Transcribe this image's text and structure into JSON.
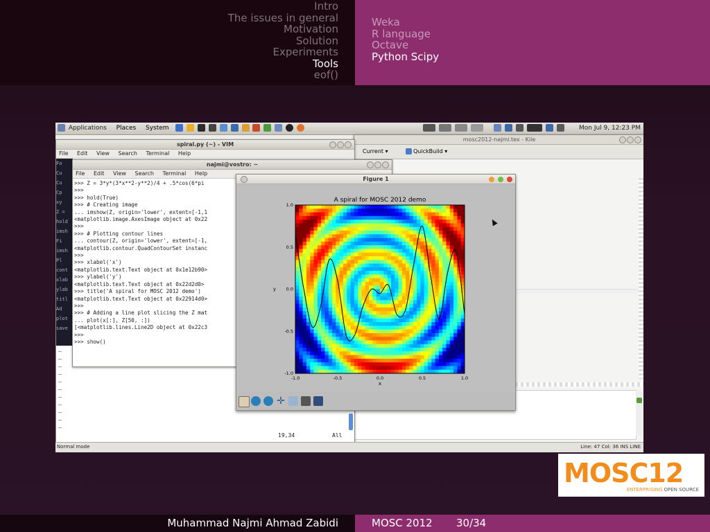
{
  "header": {
    "sections": [
      "Intro",
      "The issues in general",
      "Motivation",
      "Solution",
      "Experiments",
      "Tools",
      "eof()"
    ],
    "active_section": 5,
    "subsections": [
      "Weka",
      "R language",
      "Octave",
      "Python Scipy"
    ],
    "active_subsection": 3
  },
  "footer": {
    "author": "Muhammad Najmi Ahmad Zabidi",
    "conference": "MOSC 2012",
    "page": "30/34"
  },
  "logo": {
    "text_prefix": "M",
    "text_o": "O",
    "text_suffix": "SC12",
    "tagline_a": "ENTERPRISING",
    "tagline_b": " OPEN SOURCE"
  },
  "desktop": {
    "panel": {
      "menus": [
        "Applications",
        "Places",
        "System"
      ],
      "clock": "Mon Jul 9, 12:23 PM"
    },
    "vim": {
      "title": "spiral.py (~) - VIM",
      "menu": [
        "File",
        "Edit",
        "View",
        "Search",
        "Terminal",
        "Help"
      ],
      "cursor_pos": "19,34",
      "scroll_pos": "All",
      "left_frags": [
        "Fo",
        "Cu",
        "Cu",
        "Cp",
        "xy",
        "Z =",
        "hold",
        "imsh",
        "Fi",
        "imsh",
        "Pl",
        "cont",
        "xlab",
        "ylab",
        "titl",
        "Ad",
        "plot",
        "save"
      ]
    },
    "kile": {
      "title": "mosc2012-najmi.tex - Kile",
      "build_label": "Current",
      "quickbuild": "QuickBuild"
    },
    "terminal": {
      "title": "najmi@vostro: ~",
      "menu": [
        "File",
        "Edit",
        "View",
        "Search",
        "Terminal",
        "Help"
      ],
      "lines": [
        ">>> Z = 3*y*(3*x**2-y**2)/4 + .5*cos(6*pi",
        ">>>",
        ">>> hold(True)",
        ">>> # Creating image",
        "... imshow(Z, origin='lower', extent=[-1,1",
        "<matplotlib.image.AxesImage object at 0x22",
        ">>>",
        ">>> # Plotting contour lines",
        "... contour(Z, origin='lower', extent=[-1,",
        "<matplotlib.contour.QuadContourSet instanc",
        ">>>",
        ">>> xlabel('x')",
        "<matplotlib.text.Text object at 0x1e12b90>",
        ">>> ylabel('y')",
        "<matplotlib.text.Text object at 0x22d2d0>",
        ">>> title('A spiral for MOSC 2012 demo')",
        "<matplotlib.text.Text object at 0x22914d0>",
        ">>>",
        ">>> # Adding a line plot slicing the Z mat",
        "... plot(x[:], Z[50, :])",
        "[<matplotlib.lines.Line2D object at 0x22c3",
        ">>>",
        ">>> show()"
      ]
    },
    "statusbar": {
      "left": "Normal mode",
      "right": "Line: 47 Col: 36  INS  LINE"
    },
    "figure": {
      "title": "Figure 1"
    }
  },
  "chart_data": {
    "type": "heatmap",
    "title": "A spiral for MOSC 2012 demo",
    "xlabel": "x",
    "ylabel": "y",
    "xlim": [
      -1.0,
      1.0
    ],
    "ylim": [
      -1.0,
      1.0
    ],
    "xticks": [
      "-1.0",
      "-0.5",
      "0.0",
      "0.5",
      "1.0"
    ],
    "yticks": [
      "1.0",
      "0.5",
      "0.0",
      "-0.5",
      "-1.0"
    ],
    "colormap": "jet",
    "line_series": {
      "x": [
        -1.0,
        -0.9,
        -0.8,
        -0.7,
        -0.6,
        -0.5,
        -0.4,
        -0.3,
        -0.2,
        -0.1,
        0.0,
        0.1,
        0.2,
        0.3,
        0.4,
        0.5,
        0.6,
        0.7,
        0.8,
        0.9,
        1.0
      ],
      "y": [
        0.65,
        0.0,
        -0.45,
        -0.2,
        0.35,
        0.1,
        -0.55,
        -0.55,
        -0.2,
        0.0,
        -0.05,
        0.05,
        -0.3,
        -0.25,
        0.3,
        0.75,
        0.15,
        -0.35,
        0.2,
        0.45,
        -0.3
      ]
    }
  },
  "colors": {
    "header_left": "#1a060f",
    "header_right": "#8e2d6e",
    "logo_orange": "#f28c1c"
  }
}
